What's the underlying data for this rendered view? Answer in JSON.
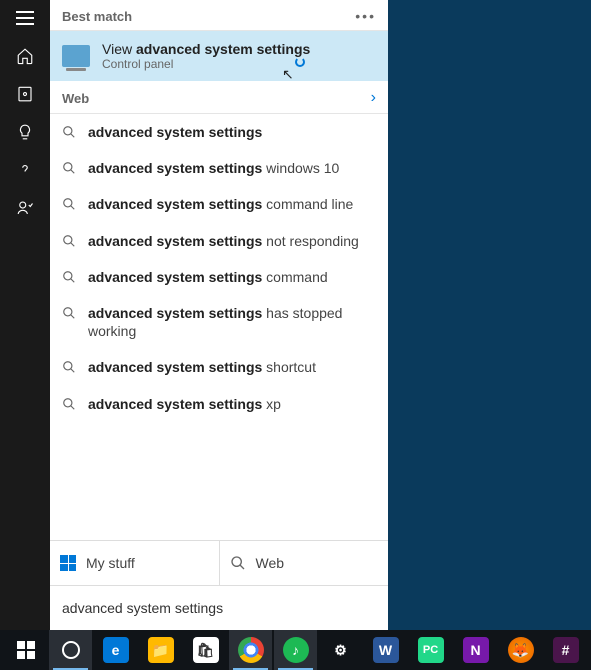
{
  "sidebar": {
    "items": [
      "menu",
      "home",
      "apps",
      "tips",
      "help",
      "account"
    ]
  },
  "panel": {
    "best_match_label": "Best match",
    "best_match": {
      "prefix": "View ",
      "bold": "advanced system settings",
      "subtitle": "Control panel"
    },
    "web_label": "Web",
    "suggestions": [
      {
        "bold": "advanced system settings",
        "rest": ""
      },
      {
        "bold": "advanced system settings",
        "rest": " windows 10"
      },
      {
        "bold": "advanced system settings",
        "rest": " command line"
      },
      {
        "bold": "advanced system settings",
        "rest": " not responding"
      },
      {
        "bold": "advanced system settings",
        "rest": " command"
      },
      {
        "bold": "advanced system settings",
        "rest": " has stopped working"
      },
      {
        "bold": "advanced system settings",
        "rest": " shortcut"
      },
      {
        "bold": "advanced system settings",
        "rest": " xp"
      }
    ],
    "filters": {
      "mystuff": "My stuff",
      "web": "Web"
    },
    "search_value": "advanced system settings"
  },
  "taskbar": {
    "items": [
      "start",
      "cortana",
      "edge",
      "file-explorer",
      "store",
      "chrome",
      "spotify",
      "settings",
      "word",
      "pycharm",
      "onenote",
      "firefox",
      "slack"
    ]
  }
}
